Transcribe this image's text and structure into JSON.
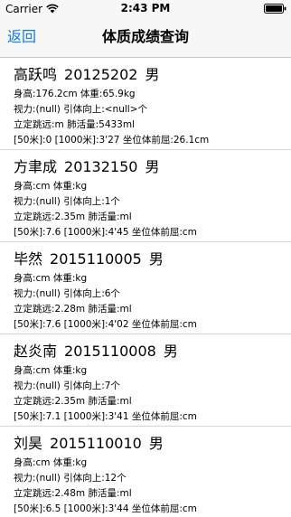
{
  "status_bar": {
    "carrier": "Carrier",
    "time": "2:43 PM"
  },
  "nav": {
    "back_label": "返回",
    "title": "体质成绩查询"
  },
  "records": [
    {
      "name": "高跃鸣",
      "id": "20125202",
      "gender": "男",
      "line1": "身高:176.2cm  体重:65.9kg",
      "line2": "视力:(null)  引体向上:<null>个",
      "line3": "立定跳远:m  肺活量:5433ml",
      "line4": "[50米]:0 [1000米]:3'27 坐位体前屈:26.1cm"
    },
    {
      "name": "方聿成",
      "id": "20132150",
      "gender": "男",
      "line1": "身高:cm  体重:kg",
      "line2": "视力:(null)  引体向上:1个",
      "line3": "立定跳远:2.35m  肺活量:ml",
      "line4": "[50米]:7.6 [1000米]:4'45 坐位体前屈:cm"
    },
    {
      "name": "毕然",
      "id": "2015110005",
      "gender": "男",
      "line1": "身高:cm  体重:kg",
      "line2": "视力:(null)  引体向上:6个",
      "line3": "立定跳远:2.28m  肺活量:ml",
      "line4": "[50米]:7.6 [1000米]:4'02 坐位体前屈:cm"
    },
    {
      "name": "赵炎南",
      "id": "2015110008",
      "gender": "男",
      "line1": "身高:cm  体重:kg",
      "line2": "视力:(null)  引体向上:7个",
      "line3": "立定跳远:2.35m  肺活量:ml",
      "line4": "[50米]:7.1 [1000米]:3'41 坐位体前屈:cm"
    },
    {
      "name": "刘昊",
      "id": "2015110010",
      "gender": "男",
      "line1": "身高:cm  体重:kg",
      "line2": "视力:(null)  引体向上:12个",
      "line3": "立定跳远:2.48m  肺活量:ml",
      "line4": "[50米]:6.5 [1000米]:3'44 坐位体前屈:cm"
    }
  ]
}
